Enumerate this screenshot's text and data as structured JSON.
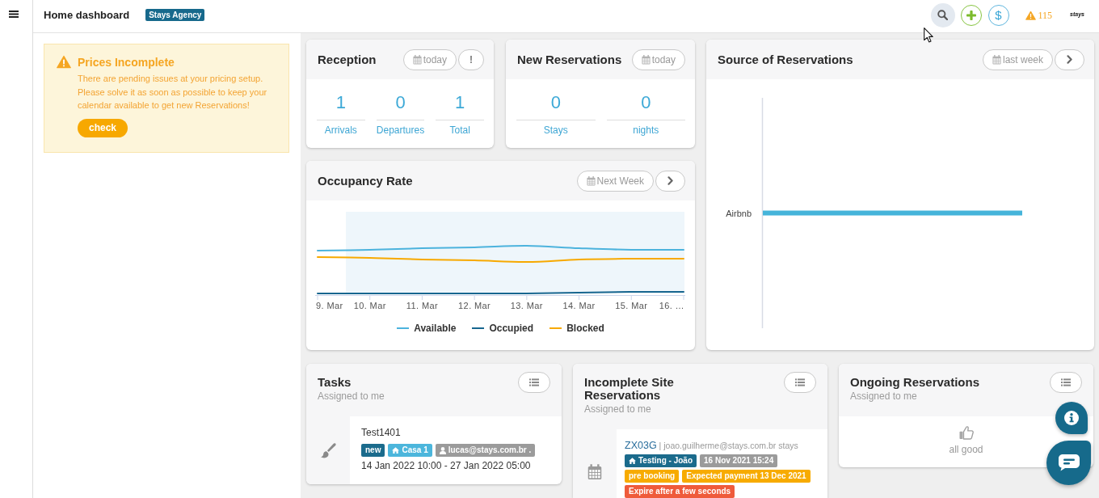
{
  "topbar": {
    "title": "Home dashboard",
    "agency": "Stays Agency",
    "currency_button": "$",
    "warnings_count": "115",
    "logo": "stays"
  },
  "alert": {
    "title": "Prices Incomplete",
    "message": "There are pending issues at your pricing setup. Please solve it as soon as possible to keep your calendar available to get new Reservations!",
    "button": "check"
  },
  "reception": {
    "title": "Reception",
    "period_button": "today",
    "more_button": "!",
    "stats": [
      {
        "value": "1",
        "label": "Arrivals"
      },
      {
        "value": "0",
        "label": "Departures"
      },
      {
        "value": "1",
        "label": "Total"
      }
    ]
  },
  "new_reservations": {
    "title": "New Reservations",
    "period_button": "today",
    "stats": [
      {
        "value": "0",
        "label": "Stays"
      },
      {
        "value": "0",
        "label": "nights"
      }
    ]
  },
  "occupancy_rate": {
    "title": "Occupancy Rate",
    "period_button": "Next Week",
    "x_labels": [
      "9. Mar",
      "10. Mar",
      "11. Mar",
      "12. Mar",
      "13. Mar",
      "14. Mar",
      "15. Mar",
      "16. …"
    ],
    "legend": [
      {
        "label": "Available",
        "color": "#4cb3dd"
      },
      {
        "label": "Occupied",
        "color": "#17668f"
      },
      {
        "label": "Blocked",
        "color": "#f7a900"
      }
    ]
  },
  "source_of_reservations": {
    "title": "Source of Reservations",
    "period_button": "last week",
    "bar_labels": [
      "Airbnb"
    ]
  },
  "tasks": {
    "title": "Tasks",
    "subtitle": "Assigned to me",
    "items": [
      {
        "title": "Test1401",
        "badges": [
          {
            "text": "new",
            "kind": "status",
            "color": "#1b6b8c"
          },
          {
            "text": "Casa 1",
            "kind": "listing",
            "color": "#4cb6dc"
          },
          {
            "text": "lucas@stays.com.br .",
            "kind": "user",
            "color": "#9b9b9b"
          }
        ],
        "dates": "14 Jan 2022 10:00 - 27 Jan 2022 05:00"
      }
    ]
  },
  "incomplete_site_reservations": {
    "title": "Incomplete Site Reservations",
    "subtitle": "Assigned to me",
    "items": [
      {
        "code": "ZX03G",
        "details": "| joao.guilherme@stays.com.br stays",
        "badge_rows": [
          [
            {
              "text": "Testing - João",
              "kind": "listing",
              "color": "#1b6b8c"
            },
            {
              "text": "16 Nov 2021 15:24",
              "kind": "date",
              "color": "#9b9b9b"
            }
          ],
          [
            {
              "text": "pre booking",
              "kind": "status",
              "color": "#f7ab00"
            },
            {
              "text": "Expected payment 13 Dec 2021",
              "kind": "payment",
              "color": "#f7ab00"
            }
          ],
          [
            {
              "text": "Expire after a few seconds",
              "kind": "expiry",
              "color": "#ef5b3b"
            }
          ]
        ]
      }
    ]
  },
  "ongoing_reservations": {
    "title": "Ongoing Reservations",
    "subtitle": "Assigned to me",
    "empty_message": "all good"
  }
}
